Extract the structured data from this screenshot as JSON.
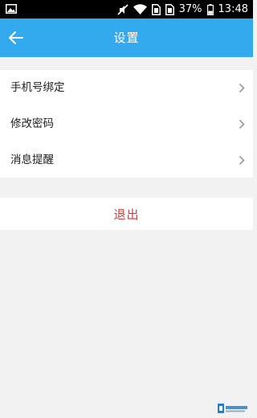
{
  "status_bar": {
    "battery_percent": "37%",
    "time": "13:48",
    "icons": [
      "image-icon",
      "mute-icon",
      "wifi-icon",
      "sim-icon",
      "sim-icon",
      "battery-icon"
    ]
  },
  "header": {
    "title": "设置",
    "back_icon": "back-arrow-icon",
    "color": "#33a9ee"
  },
  "settings": {
    "items": [
      {
        "label": "手机号绑定",
        "icon": "chevron-right-icon"
      },
      {
        "label": "修改密码",
        "icon": "chevron-right-icon"
      },
      {
        "label": "消息提醒",
        "icon": "chevron-right-icon"
      }
    ]
  },
  "logout": {
    "label": "退出",
    "color": "#d9383a"
  },
  "watermark": {
    "icon": "logo-icon"
  }
}
